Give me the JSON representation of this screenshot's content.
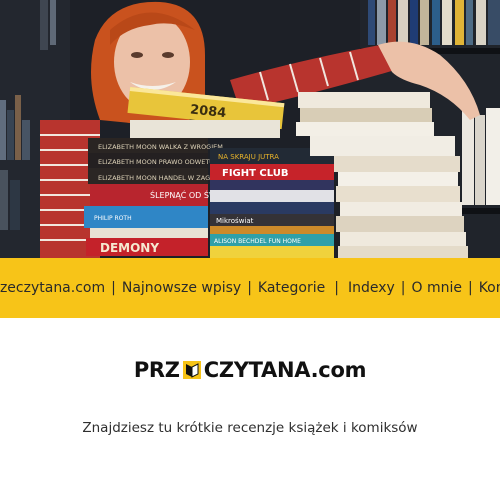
{
  "nav": {
    "items": [
      {
        "label": "Przeczytana.com"
      },
      {
        "label": "Najnowsze wpisy"
      },
      {
        "label": "Kategorie"
      },
      {
        "label": "Indexy"
      },
      {
        "label": "O mnie"
      },
      {
        "label": "Kontakt"
      }
    ],
    "separator": "|"
  },
  "brand": {
    "logo_pre": "PRZ",
    "logo_post": "CZYTANA.com",
    "tagline": "Znajdziesz tu krótkie recenzje książek i komiksów"
  },
  "hero": {
    "book_spines": [
      "ELIZABETH MOON WALKA Z WROGIEM",
      "ELIZABETH MOON PRAWO ODWETU",
      "ELIZABETH MOON HANDEL W ZAGROŻENIU",
      "ŚLEPNĄĆ OD ŚWIATEŁ",
      "PHILIP ROTH",
      "DEMONY",
      "NA SKRAJU JUTRA",
      "FIGHT CLUB",
      "Mikroświat",
      "ALISON BECHDEL FUN HOME"
    ]
  },
  "colors": {
    "nav_bg": "#f7c418",
    "hero_bg": "#1c1f26",
    "page_bg": "#ffffff"
  }
}
